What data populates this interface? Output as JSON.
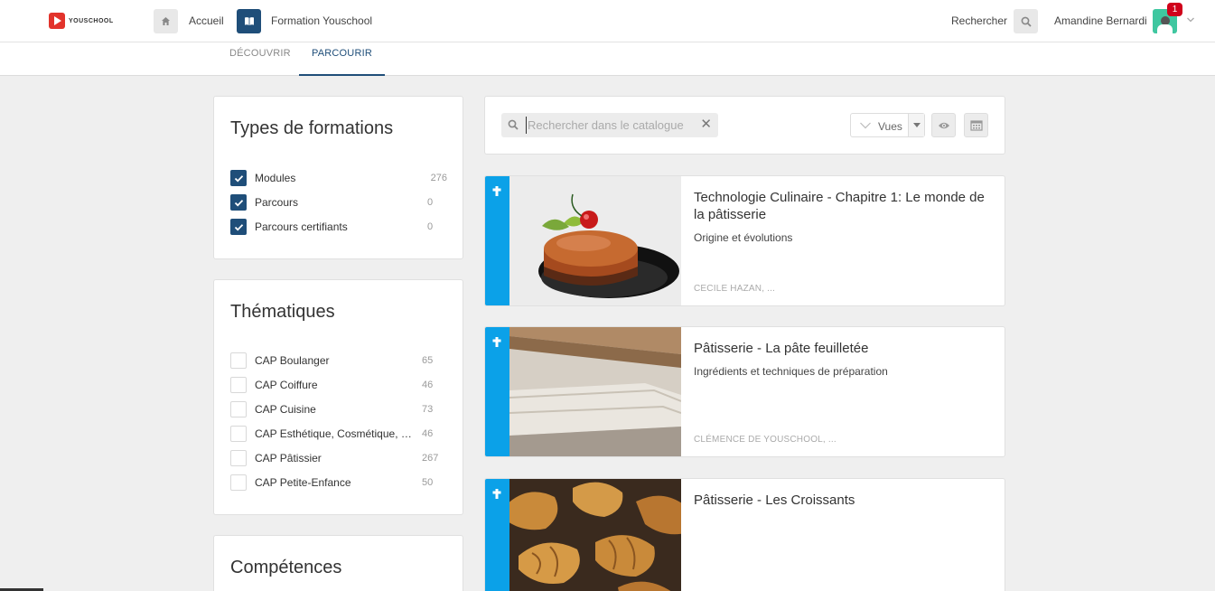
{
  "header": {
    "logo_text": "YOUSCHOOL",
    "nav_home": "Accueil",
    "nav_training": "Formation Youschool",
    "search_label": "Rechercher",
    "user_name": "Amandine Bernardi",
    "notification_count": "1"
  },
  "tabs": [
    {
      "label": "DÉCOUVRIR"
    },
    {
      "label": "PARCOURIR"
    }
  ],
  "filters": {
    "types": {
      "title": "Types de formations",
      "items": [
        {
          "label": "Modules",
          "count": "276",
          "checked": true
        },
        {
          "label": "Parcours",
          "count": "0",
          "checked": true
        },
        {
          "label": "Parcours certifiants",
          "count": "0",
          "checked": true
        }
      ]
    },
    "themes": {
      "title": "Thématiques",
      "items": [
        {
          "label": "CAP Boulanger",
          "count": "65",
          "checked": false
        },
        {
          "label": "CAP Coiffure",
          "count": "46",
          "checked": false
        },
        {
          "label": "CAP Cuisine",
          "count": "73",
          "checked": false
        },
        {
          "label": "CAP Esthétique, Cosmétique, Parfumerie",
          "count": "46",
          "checked": false
        },
        {
          "label": "CAP Pâtissier",
          "count": "267",
          "checked": false
        },
        {
          "label": "CAP Petite-Enfance",
          "count": "50",
          "checked": false
        }
      ]
    },
    "skills": {
      "title": "Compétences"
    }
  },
  "catalogue": {
    "search_placeholder": "Rechercher dans le catalogue",
    "view_label": "Vues"
  },
  "courses": [
    {
      "title": "Technologie Culinaire - Chapitre 1: Le monde de la pâtisserie",
      "subtitle": "Origine et évolutions",
      "author": "CECILE HAZAN, ..."
    },
    {
      "title": "Pâtisserie - La pâte feuilletée",
      "subtitle": "Ingrédients et techniques de préparation",
      "author": "CLÉMENCE DE YOUSCHOOL, ..."
    },
    {
      "title": "Pâtisserie - Les Croissants",
      "subtitle": "",
      "author": ""
    }
  ],
  "colors": {
    "primary": "#1f4e79",
    "accent_stripe": "#0ba1e8",
    "notification": "#d0021b",
    "logo": "#e2332b"
  }
}
